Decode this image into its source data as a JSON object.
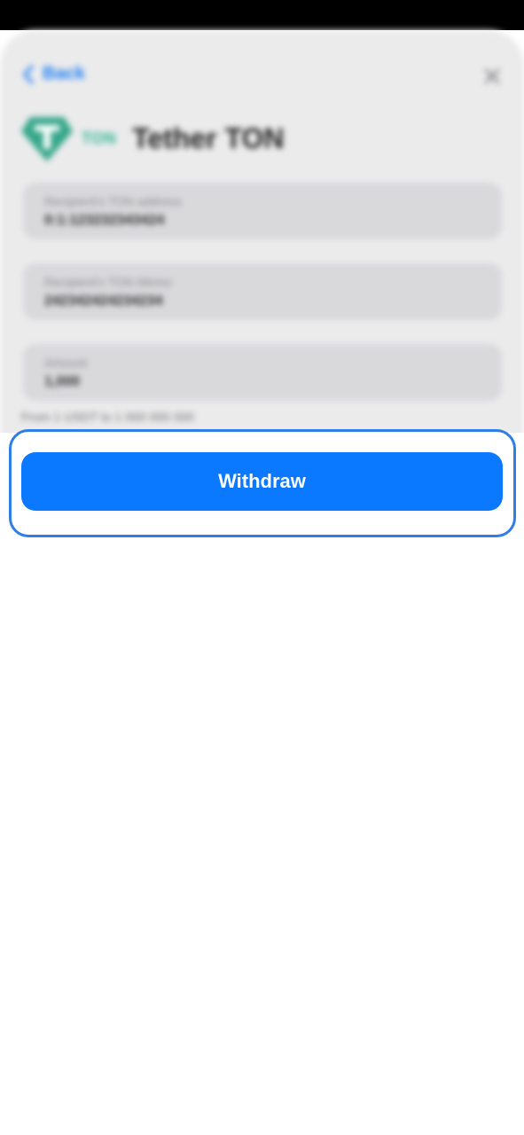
{
  "header": {
    "back_label": "Back"
  },
  "token": {
    "network": "TON",
    "title": "Tether TON",
    "logo_color": "#36a78a"
  },
  "fields": [
    {
      "label": "Recipient's TON address",
      "value": "0:1:123232343424"
    },
    {
      "label": "Recipient's TON Memo",
      "value": "242342424234234"
    },
    {
      "label": "Amount",
      "value": "1,000"
    }
  ],
  "hint": "From 1 USDT to 1 000 000 000",
  "actions": {
    "withdraw_label": "Withdraw"
  },
  "colors": {
    "accent": "#0a78ff",
    "highlight_border": "#2f7ee6"
  }
}
